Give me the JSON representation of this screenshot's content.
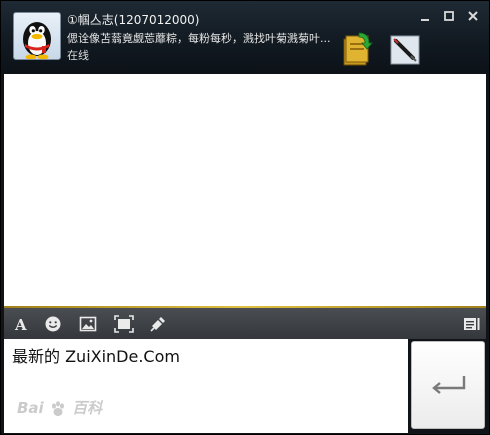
{
  "contact": {
    "name": "①帼亼志(1207012000)",
    "signature": "偲诠像苫蓊竟觑莣蘼粽，每粉每秒，溅找叶菊溅菊叶...",
    "status": "在线"
  },
  "window_controls": {
    "minimize_icon": "minimize-icon",
    "maximize_icon": "maximize-icon",
    "close_icon": "close-icon"
  },
  "toolbar": {
    "icons": [
      "font-icon",
      "emoji-icon",
      "image-icon",
      "screenshot-icon",
      "shake-icon",
      "message-history-icon"
    ]
  },
  "input": {
    "value": "最新的 ZuiXinDe.Com"
  },
  "send_button": {
    "icon": "enter-arrow-icon"
  },
  "watermark": {
    "text_left": "Bai",
    "text_right": "百科"
  },
  "colors": {
    "header_bg": "#121a22",
    "accent_line": "#e0c040",
    "toolbar_bg": "#3a3e42"
  }
}
